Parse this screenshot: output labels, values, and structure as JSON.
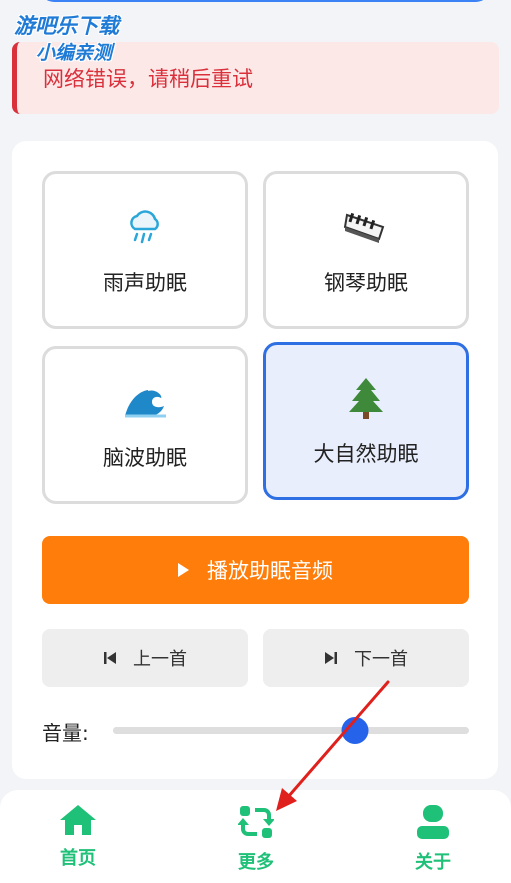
{
  "watermark": {
    "line1": "游吧乐下载",
    "line2": "小编亲测"
  },
  "error": {
    "message": "网络错误，请稍后重试"
  },
  "tiles": [
    {
      "label": "雨声助眠",
      "icon": "rain-cloud-icon",
      "selected": false
    },
    {
      "label": "钢琴助眠",
      "icon": "piano-icon",
      "selected": false
    },
    {
      "label": "脑波助眠",
      "icon": "wave-icon",
      "selected": false
    },
    {
      "label": "大自然助眠",
      "icon": "tree-icon",
      "selected": true
    }
  ],
  "player": {
    "play_label": "播放助眠音频",
    "prev_label": "上一首",
    "next_label": "下一首",
    "volume_label": "音量:",
    "volume_level": 0.68
  },
  "bottom_nav": {
    "tabs": [
      {
        "label": "首页",
        "icon": "home-icon"
      },
      {
        "label": "更多",
        "icon": "refresh-icon"
      },
      {
        "label": "关于",
        "icon": "user-icon"
      }
    ]
  },
  "colors": {
    "accent_orange": "#ff7d0a",
    "selected_blue": "#2f6fe4",
    "error_red": "#d9303b",
    "nav_green": "#1fc078",
    "annotation_red": "#e0201c"
  }
}
